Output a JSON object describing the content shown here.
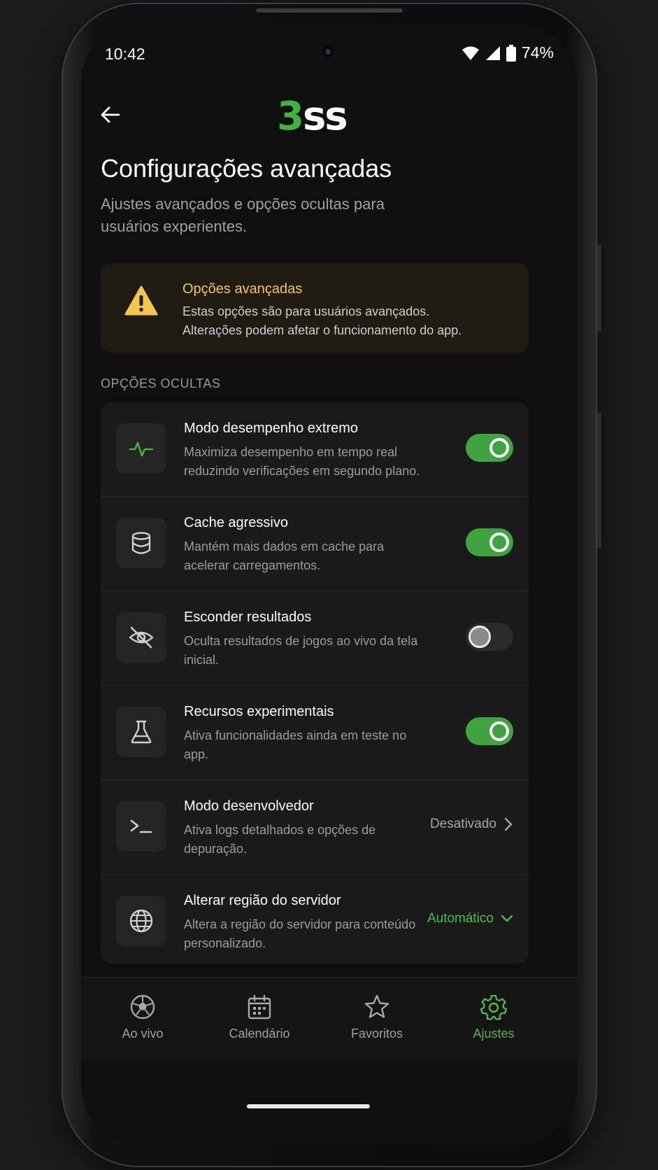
{
  "status_bar": {
    "time": "10:42",
    "battery": "74%",
    "icons": [
      "wifi-icon",
      "signal-icon",
      "battery-icon"
    ]
  },
  "header": {
    "logo_accent": "3",
    "logo_rest": "ss",
    "accent_color": "#3fb23f"
  },
  "page": {
    "title": "Configurações avançadas",
    "subtitle": "Ajustes avançados e opções ocultas para usuários experientes."
  },
  "warning": {
    "title": "Opções avançadas",
    "line1": "Estas opções são para usuários avançados.",
    "line2": "Alterações podem afetar o funcionamento do app.",
    "color": "#f3c84a"
  },
  "section": {
    "label": "OPÇÕES OCULTAS"
  },
  "settings": [
    {
      "title": "Modo desempenho extremo",
      "desc": "Maximiza desempenho em tempo real reduzindo verificações em segundo plano.",
      "icon": "activity-icon",
      "control": "toggle",
      "on": true
    },
    {
      "title": "Cache agressivo",
      "desc": "Mantém mais dados em cache para acelerar carregamentos.",
      "icon": "database-icon",
      "control": "toggle",
      "on": true
    },
    {
      "title": "Esconder resultados",
      "desc": "Oculta resultados de jogos ao vivo da tela inicial.",
      "icon": "eye-off-icon",
      "control": "toggle",
      "on": false
    },
    {
      "title": "Recursos experimentais",
      "desc": "Ativa funcionalidades ainda em teste no app.",
      "icon": "flask-icon",
      "control": "toggle",
      "on": true
    },
    {
      "title": "Modo desenvolvedor",
      "desc": "Ativa logs detalhados e opções de depuração.",
      "icon": "terminal-icon",
      "control": "link",
      "value": "Desativado"
    },
    {
      "title": "Alterar região do servidor",
      "desc": "Altera a região do servidor para conteúdo personalizado.",
      "icon": "globe-icon",
      "control": "dropdown",
      "value": "Automático"
    }
  ],
  "nav": [
    {
      "label": "Ao vivo",
      "icon": "soccer-ball-icon",
      "active": false
    },
    {
      "label": "Calendário",
      "icon": "calendar-icon",
      "active": false
    },
    {
      "label": "Favoritos",
      "icon": "star-icon",
      "active": false
    },
    {
      "label": "Ajustes",
      "icon": "gear-icon",
      "active": true
    }
  ]
}
